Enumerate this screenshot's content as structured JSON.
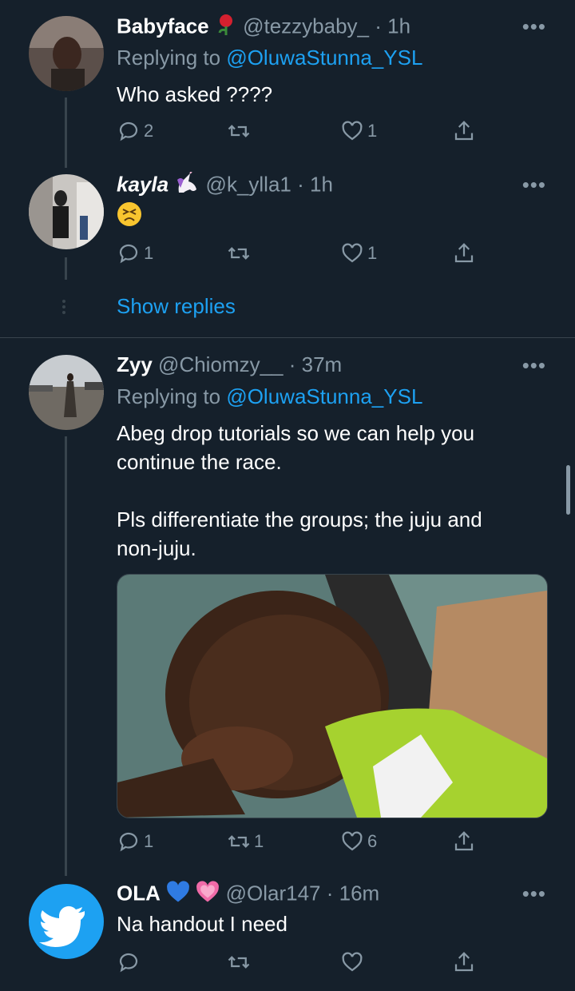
{
  "tweets": [
    {
      "name": "Babyface",
      "handle": "@tezzybaby_",
      "time": "1h",
      "replying_label": "Replying to",
      "replying_to": "@OluwaStunna_YSL",
      "text": "Who asked ????",
      "replies": "2",
      "retweets": "",
      "likes": "1"
    },
    {
      "name": "kayla",
      "handle": "@k_ylla1",
      "time": "1h",
      "text": "😣",
      "replies": "1",
      "retweets": "",
      "likes": "1"
    },
    {
      "name": "Zyy",
      "handle": "@Chiomzy__",
      "time": "37m",
      "replying_label": "Replying to",
      "replying_to": "@OluwaStunna_YSL",
      "text_line1": "Abeg drop tutorials so we can help you",
      "text_line2": "continue the race.",
      "text_line3": "Pls differentiate the groups; the juju and",
      "text_line4": "non-juju.",
      "replies": "1",
      "retweets": "1",
      "likes": "6"
    },
    {
      "name": "OLA",
      "handle": "@Olar147",
      "time": "16m",
      "text": "Na handout I need",
      "replies": "",
      "retweets": "",
      "likes": ""
    }
  ],
  "show_replies": "Show replies",
  "separator": "·",
  "more_label": "•••",
  "colors": {
    "background": "#15202b",
    "accent": "#1da1f2",
    "muted": "#8899a6",
    "line": "#38444d"
  }
}
